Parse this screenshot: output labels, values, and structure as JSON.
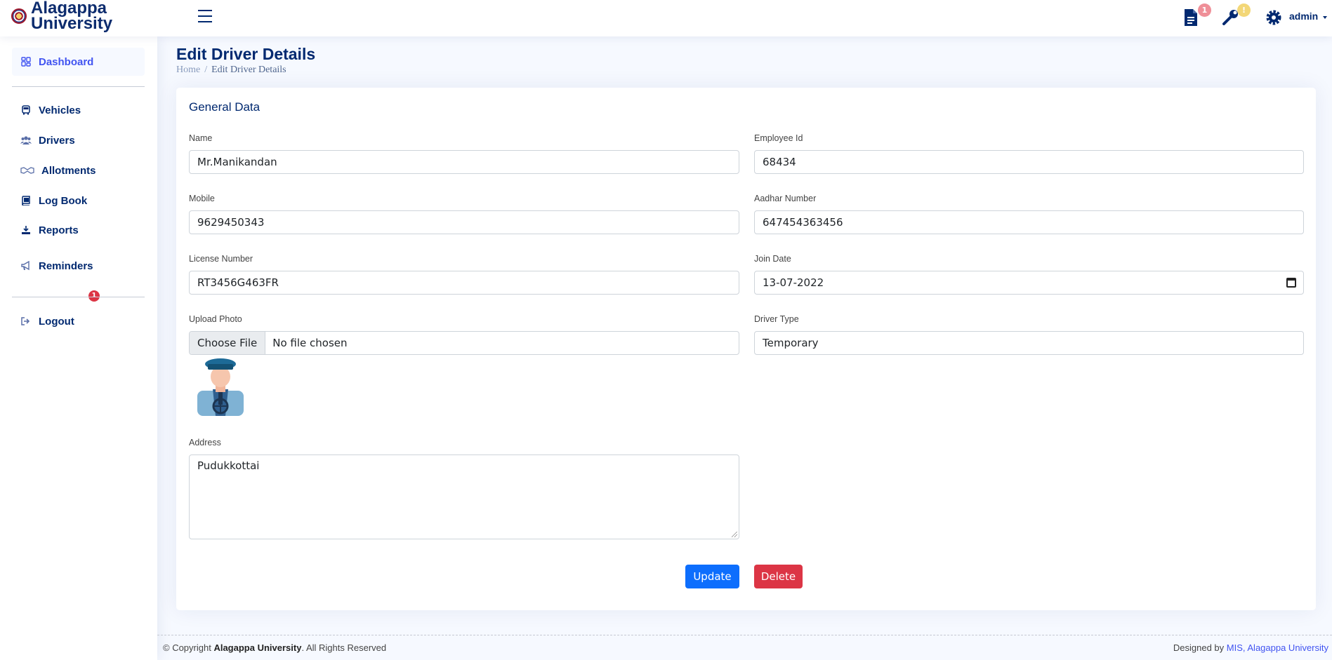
{
  "header": {
    "brand_line1": "Alagappa",
    "brand_line2": "University",
    "notes_count": "1",
    "tools_count": "!",
    "user": "admin"
  },
  "sidebar": {
    "items": [
      {
        "label": "Dashboard",
        "icon": "grid-icon",
        "active": true
      },
      {
        "label": "Vehicles",
        "icon": "bus-icon"
      },
      {
        "label": "Drivers",
        "icon": "people-icon"
      },
      {
        "label": "Allotments",
        "icon": "handshake-icon"
      },
      {
        "label": "Log Book",
        "icon": "book-icon"
      },
      {
        "label": "Reports",
        "icon": "download-icon"
      },
      {
        "label": "Reminders",
        "icon": "megaphone-icon",
        "badge": "1"
      },
      {
        "label": "Logout",
        "icon": "logout-icon"
      }
    ]
  },
  "page": {
    "title": "Edit Driver Details",
    "breadcrumb_home": "Home",
    "breadcrumb_sep": "/",
    "breadcrumb_current": "Edit Driver Details"
  },
  "form": {
    "card_title": "General Data",
    "name_label": "Name",
    "name_value": "Mr.Manikandan",
    "employee_id_label": "Employee Id",
    "employee_id_value": "68434",
    "mobile_label": "Mobile",
    "mobile_value": "9629450343",
    "aadhar_label": "Aadhar Number",
    "aadhar_value": "647454363456",
    "license_label": "License Number",
    "license_value": "RT3456G463FR",
    "join_date_label": "Join Date",
    "join_date_value": "13-07-2022",
    "photo_label": "Upload Photo",
    "photo_button": "Choose File",
    "photo_status": "No file chosen",
    "driver_type_label": "Driver Type",
    "driver_type_value": "Temporary",
    "address_label": "Address",
    "address_value": "Pudukkottai",
    "update_button": "Update",
    "delete_button": "Delete"
  },
  "footer": {
    "copyright_prefix": "© Copyright ",
    "copyright_org": "Alagappa University",
    "copyright_suffix": ". All Rights Reserved",
    "designed_prefix": "Designed by ",
    "designed_link": "MIS, Alagappa University"
  },
  "colors": {
    "primary": "#0d6efd",
    "danger": "#dc3545",
    "navy": "#012970",
    "accent": "#4154f1"
  }
}
